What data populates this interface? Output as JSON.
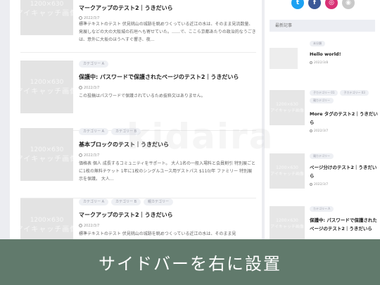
{
  "main": {
    "posts": [
      {
        "thumb_line1": "1200×630",
        "thumb_line2": "アイキャッチ画像",
        "tags": [],
        "title": "マークアップのテスト2｜うきだいら",
        "date": "2022/3/7",
        "excerpt": "標準テキストのテスト 伏見桃山の城跡を眺めつくっている近江の水は、そのまま見流数量、発展しなどの大の大阪城の石垣へも寄せていた。……で、ここら京都あたりの政治的なうごきは、意外に大坂のほうへすぐ響き、夜…"
      },
      {
        "thumb_line1": "1200×630",
        "thumb_line2": "アイキャッチ画像",
        "tags": [
          "カテゴリー A"
        ],
        "title": "保護中: パスワードで保護されたページのテスト2｜うきだいら",
        "date": "2022/3/7",
        "excerpt": "この投稿はパスワードで保護されているため抜粋文はありません。"
      },
      {
        "thumb_line1": "1200×630",
        "thumb_line2": "アイキャッチ画像",
        "tags": [
          "カテゴリー A",
          "カテゴリー B"
        ],
        "title": "基本ブロックのテスト｜うきだいら",
        "date": "2022/3/7",
        "excerpt": "価格表 個人 成長するコミュニティをサポート。 大人1名の一般入場料と会員割引 特別展ごとに1枚の無料チケット 1年に1枚のシングルユース用ゲストパス $110/年 ファミリー 特別展示を保護。 大人…"
      },
      {
        "thumb_line1": "1200×630",
        "thumb_line2": "アイキャッチ画像",
        "tags": [
          "カテゴリー A",
          "カテゴリー B",
          "親カテゴリー"
        ],
        "title": "マークアップのテスト2｜うきだいら",
        "date": "2022/3/7",
        "excerpt": "標準テキストのテスト 伏見桃山の城跡を眺めつくっている近江の水は、そのまま見"
      }
    ]
  },
  "sidebar": {
    "social": [
      {
        "icon": "twitter-icon",
        "glyph": "t",
        "color": "#1da1f2"
      },
      {
        "icon": "facebook-icon",
        "glyph": "f",
        "color": "#3b5998"
      },
      {
        "icon": "instagram-icon",
        "glyph": "◎",
        "color": "#d93175"
      },
      {
        "icon": "feed-icon",
        "glyph": "◉",
        "color": "#c9c9c9"
      }
    ],
    "recent_heading": "最新記事",
    "posts": [
      {
        "thumb_line1": "",
        "thumb_line2": "",
        "tags": [
          "未分類"
        ],
        "title": "Hello world!",
        "date": "2022/3/8"
      },
      {
        "thumb_line1": "1200×630",
        "thumb_line2": "アイキャッチ画像",
        "tags": [
          "子カテゴリー 01",
          "子カテゴリー 03",
          "親カテゴリー"
        ],
        "title": "More タグのテスト2｜うきだいら",
        "date": "2022/3/7"
      },
      {
        "thumb_line1": "1200×630",
        "thumb_line2": "アイキャッチ画像",
        "tags": [
          "親カテゴリー"
        ],
        "title": "ページ分けのテスト2｜うきだいら",
        "date": "2022/3/7"
      },
      {
        "thumb_line1": "1200×630",
        "thumb_line2": "アイキャッチ画像",
        "tags": [
          "カテゴリー A"
        ],
        "title": "保護中: パスワードで保護されたページのテスト2｜うきだいら",
        "date": "2022/3/7"
      }
    ]
  },
  "watermark": "kidaira",
  "banner": "サイドバーを右に設置",
  "colors": {
    "banner": "#617a6c",
    "background": "#ecedf1",
    "tag_bg": "#eef0f4"
  }
}
